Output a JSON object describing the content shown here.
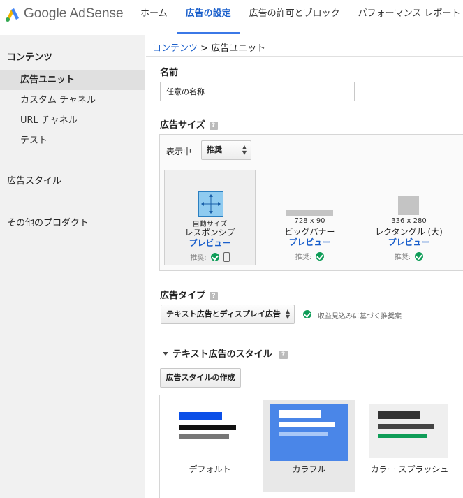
{
  "brand": {
    "name": "Google AdSense"
  },
  "nav": {
    "items": [
      {
        "label": "ホーム"
      },
      {
        "label": "広告の設定"
      },
      {
        "label": "広告の許可とブロック"
      },
      {
        "label": "パフォーマンス レポート"
      }
    ],
    "active_index": 1
  },
  "sidebar": {
    "heading": "コンテンツ",
    "items": [
      {
        "label": "広告ユニット"
      },
      {
        "label": "カスタム チャネル"
      },
      {
        "label": "URL チャネル"
      },
      {
        "label": "テスト"
      }
    ],
    "active_index": 0,
    "sections": [
      {
        "label": "広告スタイル"
      },
      {
        "label": "その他のプロダクト"
      }
    ]
  },
  "breadcrumb": {
    "link": "コンテンツ",
    "separator": " > ",
    "current": "広告ユニット"
  },
  "form": {
    "name_label": "名前",
    "name_value": "任意の名称",
    "size_label": "広告サイズ",
    "help_glyph": "?",
    "display_label": "表示中",
    "display_select": "推奨",
    "sizes": [
      {
        "sub": "自動サイズ",
        "name": "レスポンシブ",
        "preview": "プレビュー",
        "rec": "推奨:"
      },
      {
        "sub": "728 x 90",
        "name": "ビッグバナー",
        "preview": "プレビュー",
        "rec": "推奨:"
      },
      {
        "sub": "336 x 280",
        "name": "レクタングル (大)",
        "preview": "プレビュー",
        "rec": "推奨:"
      }
    ],
    "type_label": "広告タイプ",
    "type_select": "テキスト広告とディスプレイ広告",
    "type_recommendation": "収益見込みに基づく推奨案",
    "text_style_heading": "テキスト広告のスタイル",
    "create_style_button": "広告スタイルの作成",
    "styles": [
      {
        "name": "デフォルト"
      },
      {
        "name": "カラフル"
      },
      {
        "name": "カラー スプラッシュ"
      }
    ],
    "selected_style_index": 1
  },
  "colors": {
    "accent": "#3b78e7",
    "link": "#1a5fcb",
    "check": "#0f9d58",
    "responsive_icon": "#8fcbf0",
    "colorful_bg": "#4a86e8",
    "splash_green": "#0f9d58"
  }
}
